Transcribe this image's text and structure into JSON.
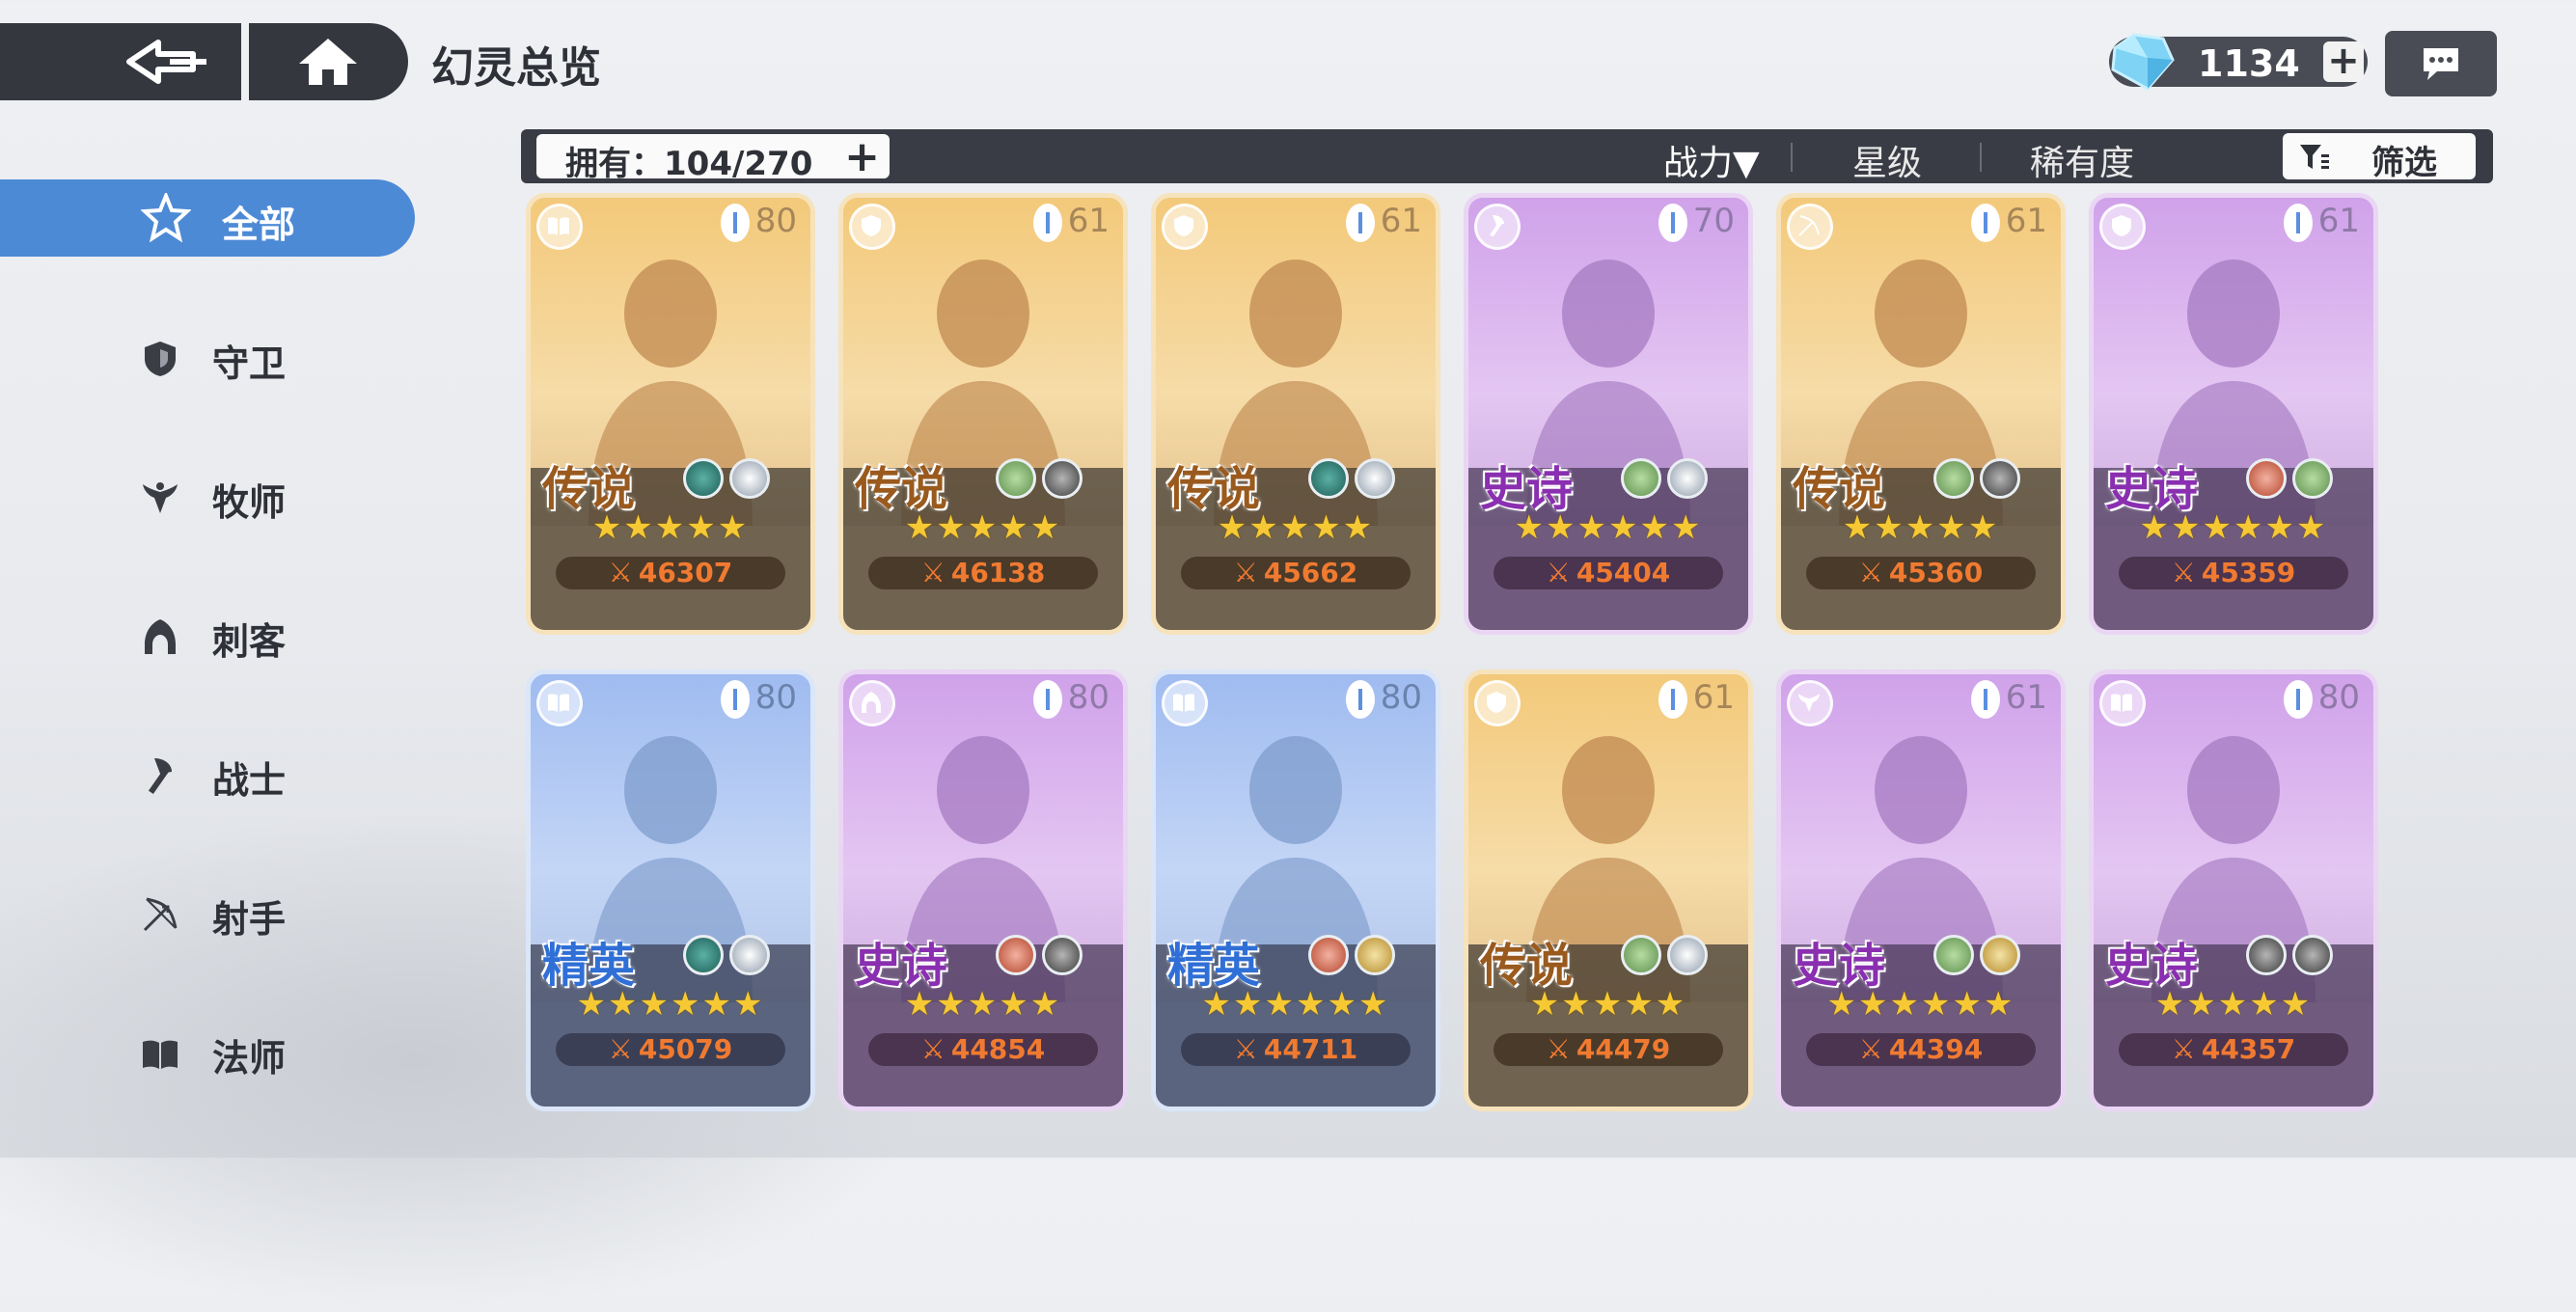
{
  "header": {
    "title": "幻灵总览"
  },
  "currency": {
    "gems": "1134",
    "add": "+"
  },
  "filterbar": {
    "owned": "拥有：104/270",
    "owned_plus": "+",
    "sort_power": "战力▼",
    "sort_star": "星级",
    "sort_rarity": "稀有度",
    "filter": "筛选"
  },
  "sidebar": {
    "items": [
      {
        "label": "全部",
        "icon": "all-star-icon",
        "active": true
      },
      {
        "label": "守卫",
        "icon": "shield-icon"
      },
      {
        "label": "牧师",
        "icon": "wings-icon"
      },
      {
        "label": "刺客",
        "icon": "hood-icon"
      },
      {
        "label": "战士",
        "icon": "axe-icon"
      },
      {
        "label": "射手",
        "icon": "bow-icon"
      },
      {
        "label": "法师",
        "icon": "book-icon"
      }
    ]
  },
  "cards": [
    {
      "rarity": "传说",
      "level": "80",
      "stars": "★★★★★",
      "power": "46307",
      "class_icon": "book-icon",
      "tier": "legend",
      "e1": "water",
      "e2": "light"
    },
    {
      "rarity": "传说",
      "level": "61",
      "stars": "★★★★★",
      "power": "46138",
      "class_icon": "shield-icon",
      "tier": "legend",
      "e1": "nature",
      "e2": "dark"
    },
    {
      "rarity": "传说",
      "level": "61",
      "stars": "★★★★★",
      "power": "45662",
      "class_icon": "shield-icon",
      "tier": "legend",
      "e1": "water",
      "e2": "light"
    },
    {
      "rarity": "史诗",
      "level": "70",
      "stars": "★★★★★★",
      "power": "45404",
      "class_icon": "axe-icon",
      "tier": "epic",
      "e1": "nature",
      "e2": "light"
    },
    {
      "rarity": "传说",
      "level": "61",
      "stars": "★★★★★",
      "power": "45360",
      "class_icon": "bow-icon",
      "tier": "legend",
      "e1": "nature",
      "e2": "dark"
    },
    {
      "rarity": "史诗",
      "level": "61",
      "stars": "★★★★★★",
      "power": "45359",
      "class_icon": "shield-icon",
      "tier": "epic",
      "e1": "fire",
      "e2": "nature"
    },
    {
      "rarity": "精英",
      "level": "80",
      "stars": "★★★★★★",
      "power": "45079",
      "class_icon": "book-icon",
      "tier": "elite",
      "e1": "water",
      "e2": "light"
    },
    {
      "rarity": "史诗",
      "level": "80",
      "stars": "★★★★★",
      "power": "44854",
      "class_icon": "hood-icon",
      "tier": "epic",
      "e1": "fire",
      "e2": "dark"
    },
    {
      "rarity": "精英",
      "level": "80",
      "stars": "★★★★★★",
      "power": "44711",
      "class_icon": "book-icon",
      "tier": "elite",
      "e1": "fire",
      "e2": "gold"
    },
    {
      "rarity": "传说",
      "level": "61",
      "stars": "★★★★★",
      "power": "44479",
      "class_icon": "shield-icon",
      "tier": "legend",
      "e1": "nature",
      "e2": "light"
    },
    {
      "rarity": "史诗",
      "level": "61",
      "stars": "★★★★★★",
      "power": "44394",
      "class_icon": "wings-icon",
      "tier": "epic",
      "e1": "nature",
      "e2": "gold"
    },
    {
      "rarity": "史诗",
      "level": "80",
      "stars": "★★★★★",
      "power": "44357",
      "class_icon": "book-icon",
      "tier": "epic",
      "e1": "dark",
      "e2": "dark"
    }
  ],
  "colors": {
    "accent": "#4d8ad6",
    "bar": "#3a3c45",
    "power": "#f07a30"
  }
}
